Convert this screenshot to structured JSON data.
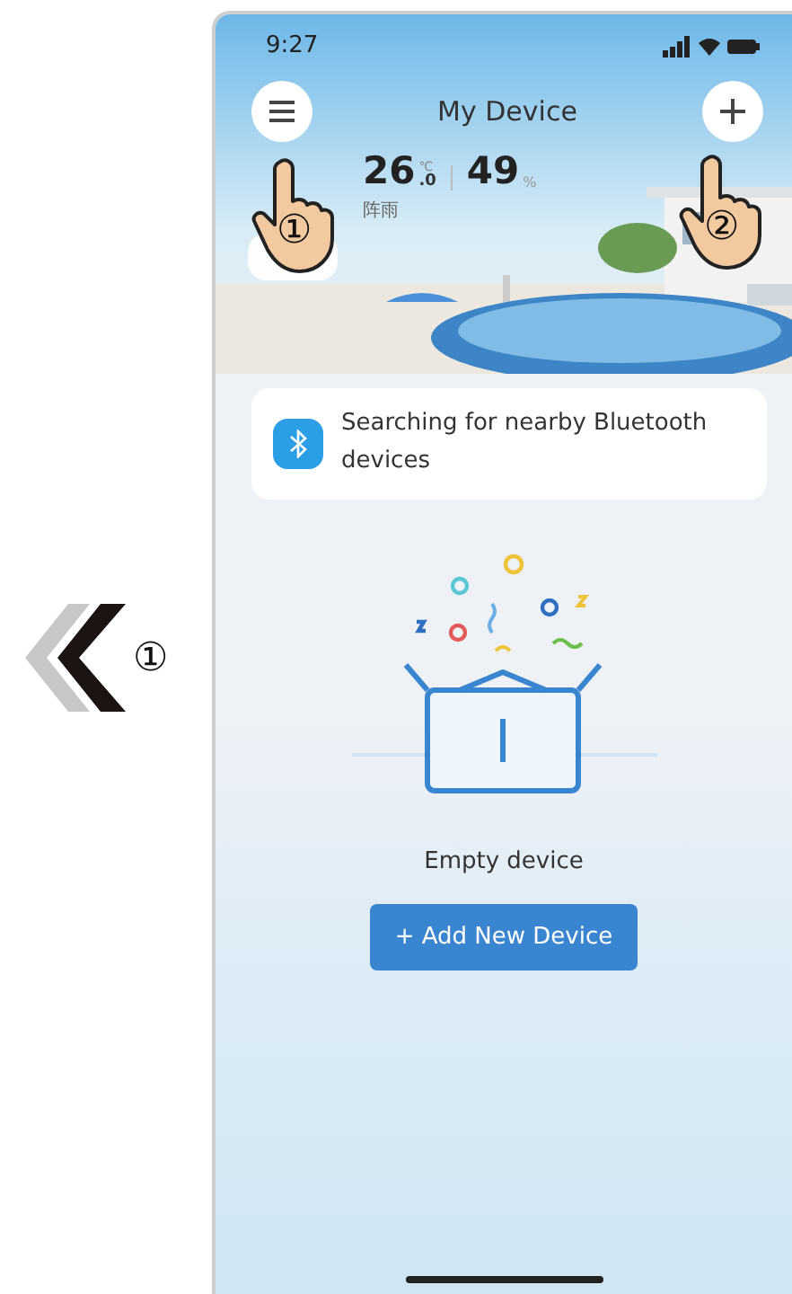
{
  "side_marker": {
    "label": "①"
  },
  "status_bar": {
    "time": "9:27"
  },
  "header": {
    "title": "My Device",
    "callouts": [
      "①",
      "②"
    ]
  },
  "weather": {
    "temperature": "26",
    "temperature_decimal": ".0",
    "temperature_unit": "℃",
    "humidity": "49",
    "humidity_unit": "%",
    "condition": "阵雨"
  },
  "bluetooth_notice": {
    "text": "Searching for nearby Bluetooth devices"
  },
  "empty_state": {
    "message": "Empty device",
    "button": "+ Add New Device"
  }
}
